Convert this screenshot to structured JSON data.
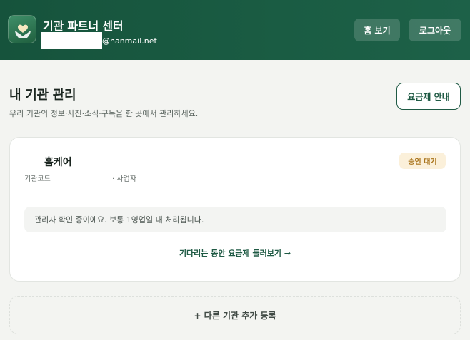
{
  "header": {
    "brand_title": "기관 파트너 센터",
    "email_domain": "@hanmail.net",
    "home_label": "홈 보기",
    "logout_label": "로그아웃"
  },
  "page": {
    "title": "내 기관 관리",
    "description": "우리 기관의 정보·사진·소식·구독을 한 곳에서 관리하세요.",
    "plan_button": "요금제 안내"
  },
  "organization": {
    "name": "홈케어",
    "code_label": "기관코드",
    "biz_label": "· 사업자",
    "status": "승인 대기",
    "notice": "관리자 확인 중이에요. 보통 1영업일 내 처리됩니다.",
    "browse_link": "기다리는 동안 요금제 둘러보기 →"
  },
  "add_button": "+ 다른 기관 추가 등록",
  "colors": {
    "header_bg": "#16533c",
    "accent": "#1f5a44",
    "badge_bg": "#fbf0da",
    "badge_text": "#a9731a"
  },
  "icons": {
    "logo": "hands-heart-icon"
  }
}
